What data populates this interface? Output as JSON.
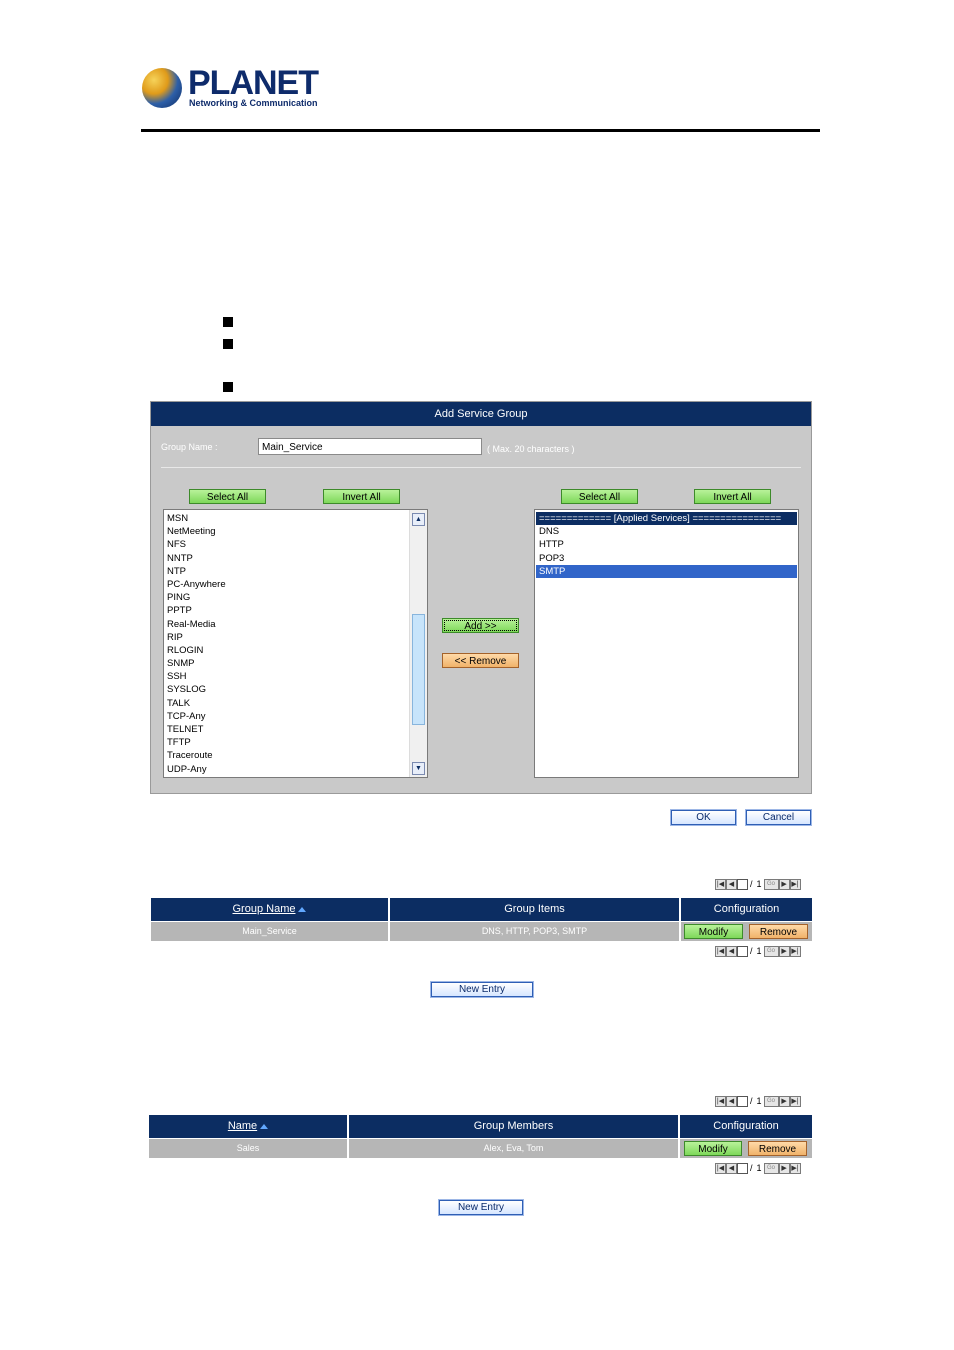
{
  "brand": {
    "name": "PLANET",
    "tagline": "Networking & Communication"
  },
  "dialog": {
    "title": "Add Service Group",
    "group_name_label": "Group Name :",
    "group_name_value": "Main_Service",
    "group_name_hint": "( Max. 20 characters )",
    "select_all": "Select All",
    "invert_all": "Invert All",
    "add": "Add >>",
    "remove": "<< Remove",
    "available_services": [
      "MSN",
      "NetMeeting",
      "NFS",
      "NNTP",
      "NTP",
      "PC-Anywhere",
      "PING",
      "PPTP",
      "Real-Media",
      "RIP",
      "RLOGIN",
      "SNMP",
      "SSH",
      "SYSLOG",
      "TALK",
      "TCP-Any",
      "TELNET",
      "TFTP",
      "Traceroute",
      "UDP-Any"
    ],
    "applied_header": "============= [Applied Services] ================",
    "applied_services": [
      "DNS",
      "HTTP",
      "POP3",
      "SMTP"
    ],
    "ok": "OK",
    "cancel": "Cancel"
  },
  "pager": {
    "separator": "/",
    "total": "1",
    "go": "Go"
  },
  "service_table": {
    "headers": [
      "Group Name",
      "Group Items",
      "Configuration"
    ],
    "row": {
      "name": "Main_Service",
      "items": "DNS, HTTP, POP3, SMTP"
    },
    "modify": "Modify",
    "remove": "Remove",
    "new_entry": "New Entry"
  },
  "user_table": {
    "headers": [
      "Name",
      "Group Members",
      "Configuration"
    ],
    "row": {
      "name": "Sales",
      "members": "Alex, Eva, Tom"
    },
    "modify": "Modify",
    "remove": "Remove",
    "new_entry": "New Entry"
  }
}
